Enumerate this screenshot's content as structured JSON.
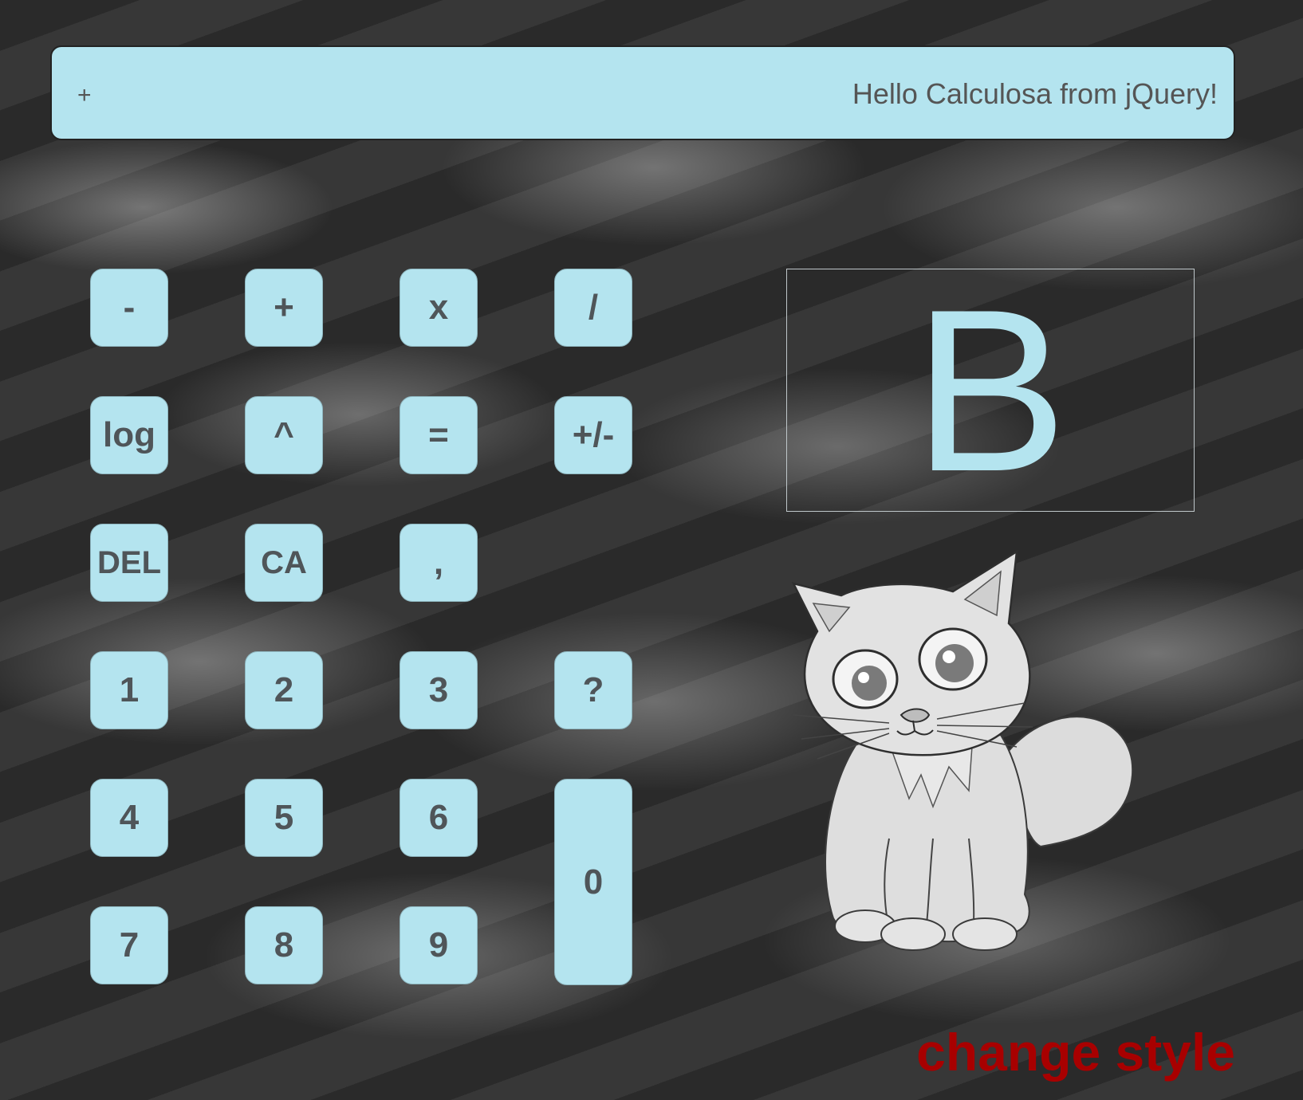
{
  "display": {
    "operator": "+",
    "message": "Hello Calculosa from jQuery!"
  },
  "keys": {
    "minus": "-",
    "plus": "+",
    "times": "x",
    "divide": "/",
    "log": "log",
    "power": "^",
    "equals": "=",
    "negate": "+/-",
    "del": "DEL",
    "ca": "CA",
    "comma": ",",
    "one": "1",
    "two": "2",
    "three": "3",
    "help": "?",
    "four": "4",
    "five": "5",
    "six": "6",
    "zero": "0",
    "seven": "7",
    "eight": "8",
    "nine": "9"
  },
  "letter_display": "B",
  "change_style_label": "change style",
  "colors": {
    "key_bg": "#b4e4ef",
    "key_text": "#4f5559",
    "change_style": "#a80000",
    "background": "#2f2f2f"
  }
}
